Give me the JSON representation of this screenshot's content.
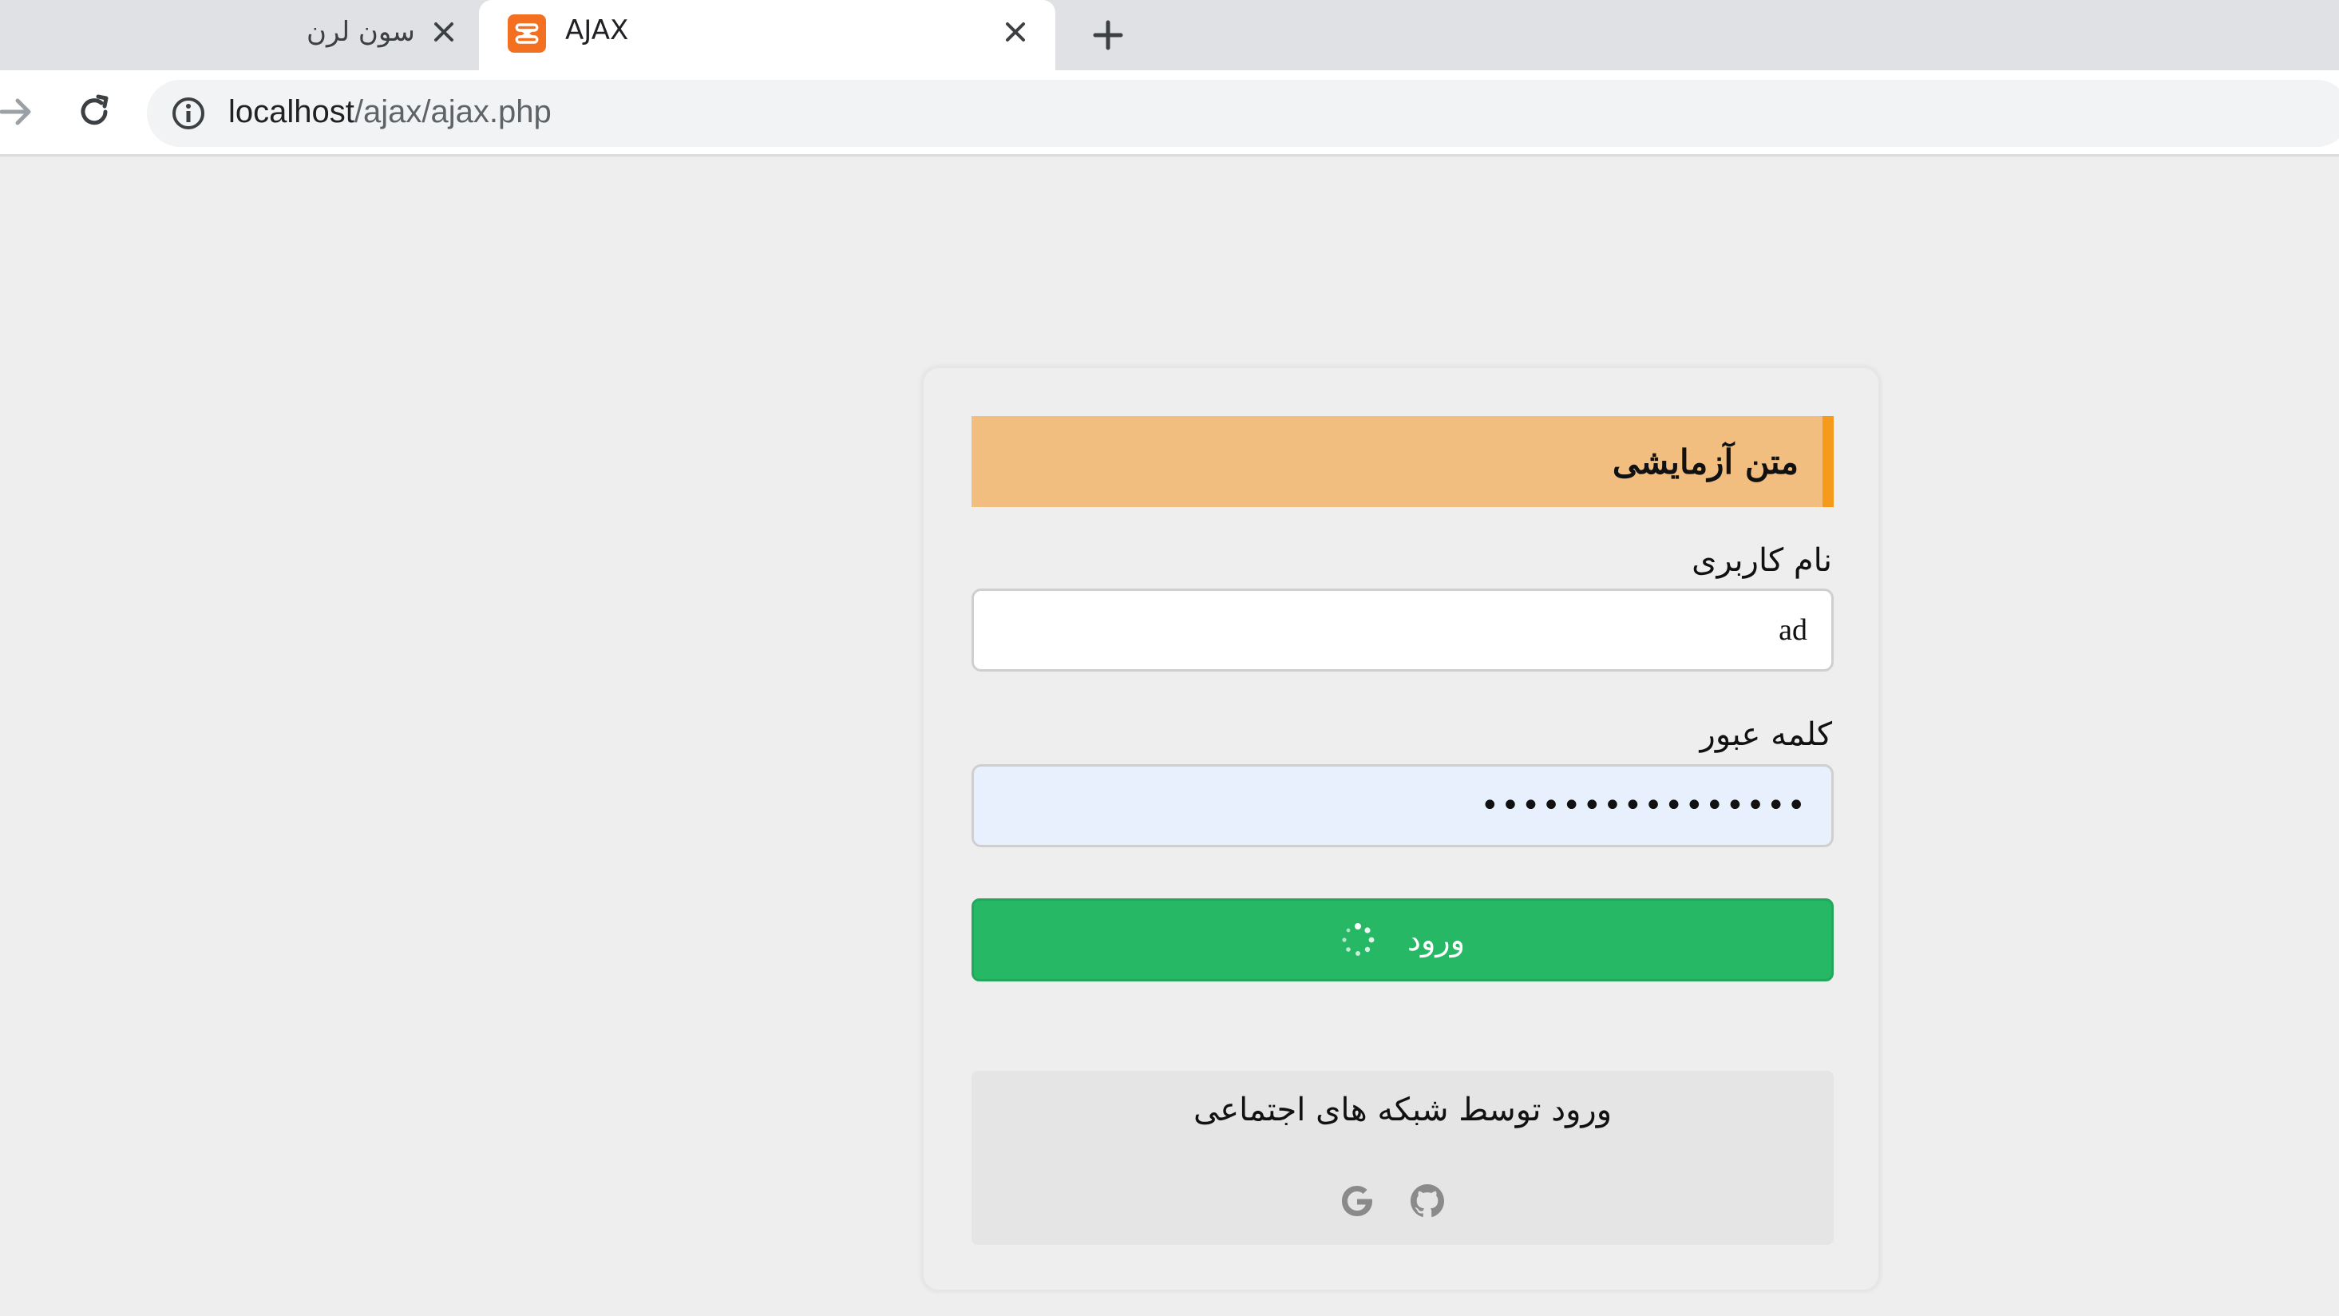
{
  "browser": {
    "tabs": [
      {
        "title": "سون لرن",
        "active": false
      },
      {
        "title": "AJAX",
        "active": true
      }
    ],
    "url_host": "localhost",
    "url_path": "/ajax/ajax.php"
  },
  "form": {
    "banner_text": "متن آزمایشی",
    "username_label": "نام کاربری",
    "username_value": "ad",
    "password_label": "کلمه عبور",
    "password_mask": "••••••••••••••••",
    "login_label": "ورود",
    "social_title": "ورود توسط شبکه های اجتماعی"
  },
  "colors": {
    "banner_bg": "#f2be80",
    "banner_accent": "#f59a1b",
    "login_button": "#27b865",
    "autofill_bg": "#e8f0fe"
  },
  "icons": [
    "favicon-xampp-icon",
    "close-icon",
    "plus-icon",
    "forward-icon",
    "reload-icon",
    "info-icon",
    "spinner-icon",
    "google-icon",
    "github-icon"
  ]
}
